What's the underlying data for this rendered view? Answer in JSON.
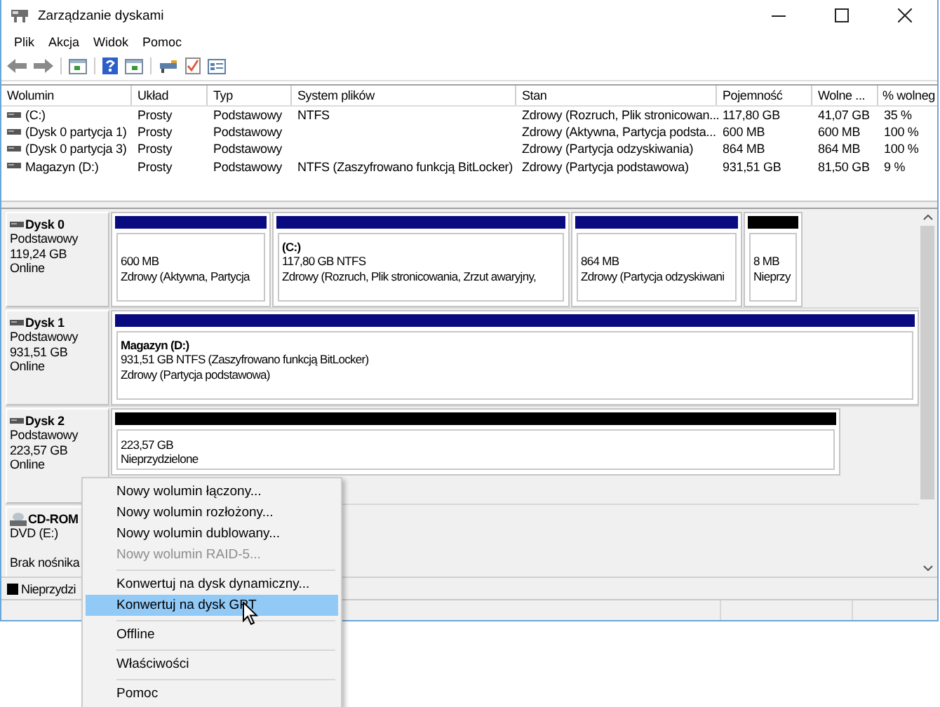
{
  "window": {
    "title": "Zarządzanie dyskami"
  },
  "menu_bar": [
    "Plik",
    "Akcja",
    "Widok",
    "Pomoc"
  ],
  "volumes": {
    "columns": [
      "Wolumin",
      "Układ",
      "Typ",
      "System plików",
      "Stan",
      "Pojemność",
      "Wolne ...",
      "% wolneg"
    ],
    "rows": [
      [
        "(C:)",
        "Prosty",
        "Podstawowy",
        "NTFS",
        "Zdrowy (Rozruch, Plik stronicowan...",
        "117,80 GB",
        "41,07 GB",
        "35 %"
      ],
      [
        "(Dysk 0 partycja 1)",
        "Prosty",
        "Podstawowy",
        "",
        "Zdrowy (Aktywna, Partycja podsta...",
        "600 MB",
        "600 MB",
        "100 %"
      ],
      [
        "(Dysk 0 partycja 3)",
        "Prosty",
        "Podstawowy",
        "",
        "Zdrowy (Partycja odzyskiwania)",
        "864 MB",
        "864 MB",
        "100 %"
      ],
      [
        "Magazyn (D:)",
        "Prosty",
        "Podstawowy",
        "NTFS (Zaszyfrowano funkcją BitLocker)",
        "Zdrowy (Partycja podstawowa)",
        "931,51 GB",
        "81,50 GB",
        "9 %"
      ]
    ]
  },
  "disks": [
    {
      "kind": "disk",
      "name": "Dysk 0",
      "lines": [
        "Podstawowy",
        "119,24 GB",
        "Online"
      ],
      "partitions": [
        {
          "kind": "primary",
          "lines": [
            "600 MB",
            "Zdrowy (Aktywna, Partycja"
          ]
        },
        {
          "kind": "primary",
          "title": "(C:)",
          "lines": [
            "117,80 GB NTFS",
            "Zdrowy (Rozruch, Plik stronicowania, Zrzut awaryjny,"
          ]
        },
        {
          "kind": "primary",
          "lines": [
            "864 MB",
            "Zdrowy (Partycja odzyskiwani"
          ]
        },
        {
          "kind": "unallocated",
          "lines": [
            "8 MB",
            "Nieprzy"
          ]
        }
      ]
    },
    {
      "kind": "disk",
      "name": "Dysk 1",
      "lines": [
        "Podstawowy",
        "931,51 GB",
        "Online"
      ],
      "partitions": [
        {
          "kind": "primary",
          "title": "Magazyn  (D:)",
          "lines": [
            "931,51 GB NTFS (Zaszyfrowano funkcją BitLocker)",
            "Zdrowy (Partycja podstawowa)"
          ]
        }
      ]
    },
    {
      "kind": "disk",
      "name": "Dysk 2",
      "lines": [
        "Podstawowy",
        "223,57 GB",
        "Online"
      ],
      "partitions": [
        {
          "kind": "unallocated",
          "lines": [
            "223,57 GB",
            "Nieprzydzielone"
          ]
        }
      ]
    },
    {
      "kind": "cdrom",
      "name": "CD-ROM",
      "lines": [
        "DVD (E:)"
      ],
      "media": "Brak nośnika"
    }
  ],
  "legend": [
    {
      "label": "Nieprzydzi",
      "color": "#000000"
    }
  ],
  "context_menu": [
    {
      "kind": "item",
      "label": "Nowy wolumin łączony...",
      "disabled": false,
      "selected": false
    },
    {
      "kind": "item",
      "label": "Nowy wolumin rozłożony...",
      "disabled": false,
      "selected": false
    },
    {
      "kind": "item",
      "label": "Nowy wolumin dublowany...",
      "disabled": false,
      "selected": false
    },
    {
      "kind": "item",
      "label": "Nowy wolumin RAID-5...",
      "disabled": true,
      "selected": false
    },
    {
      "kind": "separator"
    },
    {
      "kind": "item",
      "label": "Konwertuj na dysk dynamiczny...",
      "disabled": false,
      "selected": false
    },
    {
      "kind": "item",
      "label": "Konwertuj na dysk GPT",
      "disabled": false,
      "selected": true
    },
    {
      "kind": "separator"
    },
    {
      "kind": "item",
      "label": "Offline",
      "disabled": false,
      "selected": false
    },
    {
      "kind": "separator"
    },
    {
      "kind": "item",
      "label": "Właściwości",
      "disabled": false,
      "selected": false
    },
    {
      "kind": "separator"
    },
    {
      "kind": "item",
      "label": "Pomoc",
      "disabled": false,
      "selected": false
    }
  ]
}
